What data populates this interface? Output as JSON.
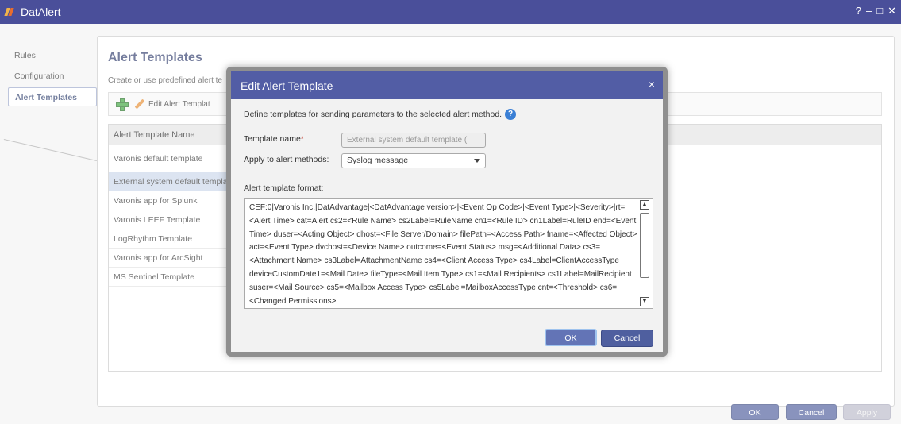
{
  "window": {
    "title": "DatAlert",
    "controls": {
      "help": "?",
      "minimize": "–",
      "maximize": "□",
      "close": "✕"
    }
  },
  "sidebar": {
    "items": [
      {
        "label": "Rules"
      },
      {
        "label": "Configuration"
      },
      {
        "label": "Alert Templates"
      }
    ]
  },
  "main": {
    "title": "Alert Templates",
    "subtitle": "Create or use predefined alert te",
    "toolbar": {
      "edit_label": "Edit Alert Templat"
    },
    "grid": {
      "header": "Alert Template Name",
      "rows": [
        "Varonis default template",
        "External system default templat",
        "Varonis app for Splunk",
        "Varonis LEEF Template",
        "LogRhythm Template",
        "Varonis app for ArcSight",
        "MS Sentinel Template"
      ]
    }
  },
  "footer": {
    "ok": "OK",
    "cancel": "Cancel",
    "apply": "Apply"
  },
  "dialog": {
    "title": "Edit Alert Template",
    "close": "×",
    "description": "Define templates for sending parameters to the selected alert method.",
    "help": "?",
    "template_name_label": "Template name",
    "required_mark": "*",
    "template_name_value": "External system default template (I",
    "apply_methods_label": "Apply to alert methods:",
    "apply_methods_value": "Syslog message",
    "format_label": "Alert template format:",
    "format_text": "CEF:0|Varonis Inc.|DatAdvantage|<DatAdvantage version>|<Event Op Code>|<Event Type>|<Severity>|rt=<Alert Time> cat=Alert cs2=<Rule Name> cs2Label=RuleName cn1=<Rule ID> cn1Label=RuleID end=<Event Time> duser=<Acting Object> dhost=<File Server/Domain> filePath=<Access Path> fname=<Affected Object> act=<Event Type> dvchost=<Device Name> outcome=<Event Status> msg=<Additional Data> cs3=<Attachment Name> cs3Label=AttachmentName cs4=<Client Access Type> cs4Label=ClientAccessType deviceCustomDate1=<Mail Date> fileType=<Mail Item Type> cs1=<Mail Recipients> cs1Label=MailRecipient suser=<Mail Source> cs5=<Mailbox Access Type> cs5Label=MailboxAccessType cnt=<Threshold> cs6=<Changed Permissions>",
    "ok": "OK",
    "cancel": "Cancel"
  },
  "colors": {
    "titlebar": "#4a4f9a",
    "dialog_header": "#525da5",
    "button": "#4a5a9a",
    "selected_row": "#c9d6ea",
    "page_title": "#2d3a6b"
  },
  "icons": [
    "app-logo-icon",
    "add-icon",
    "pencil-icon",
    "help-icon",
    "close-icon",
    "chevron-down-icon",
    "scroll-up-icon",
    "scroll-down-icon"
  ]
}
